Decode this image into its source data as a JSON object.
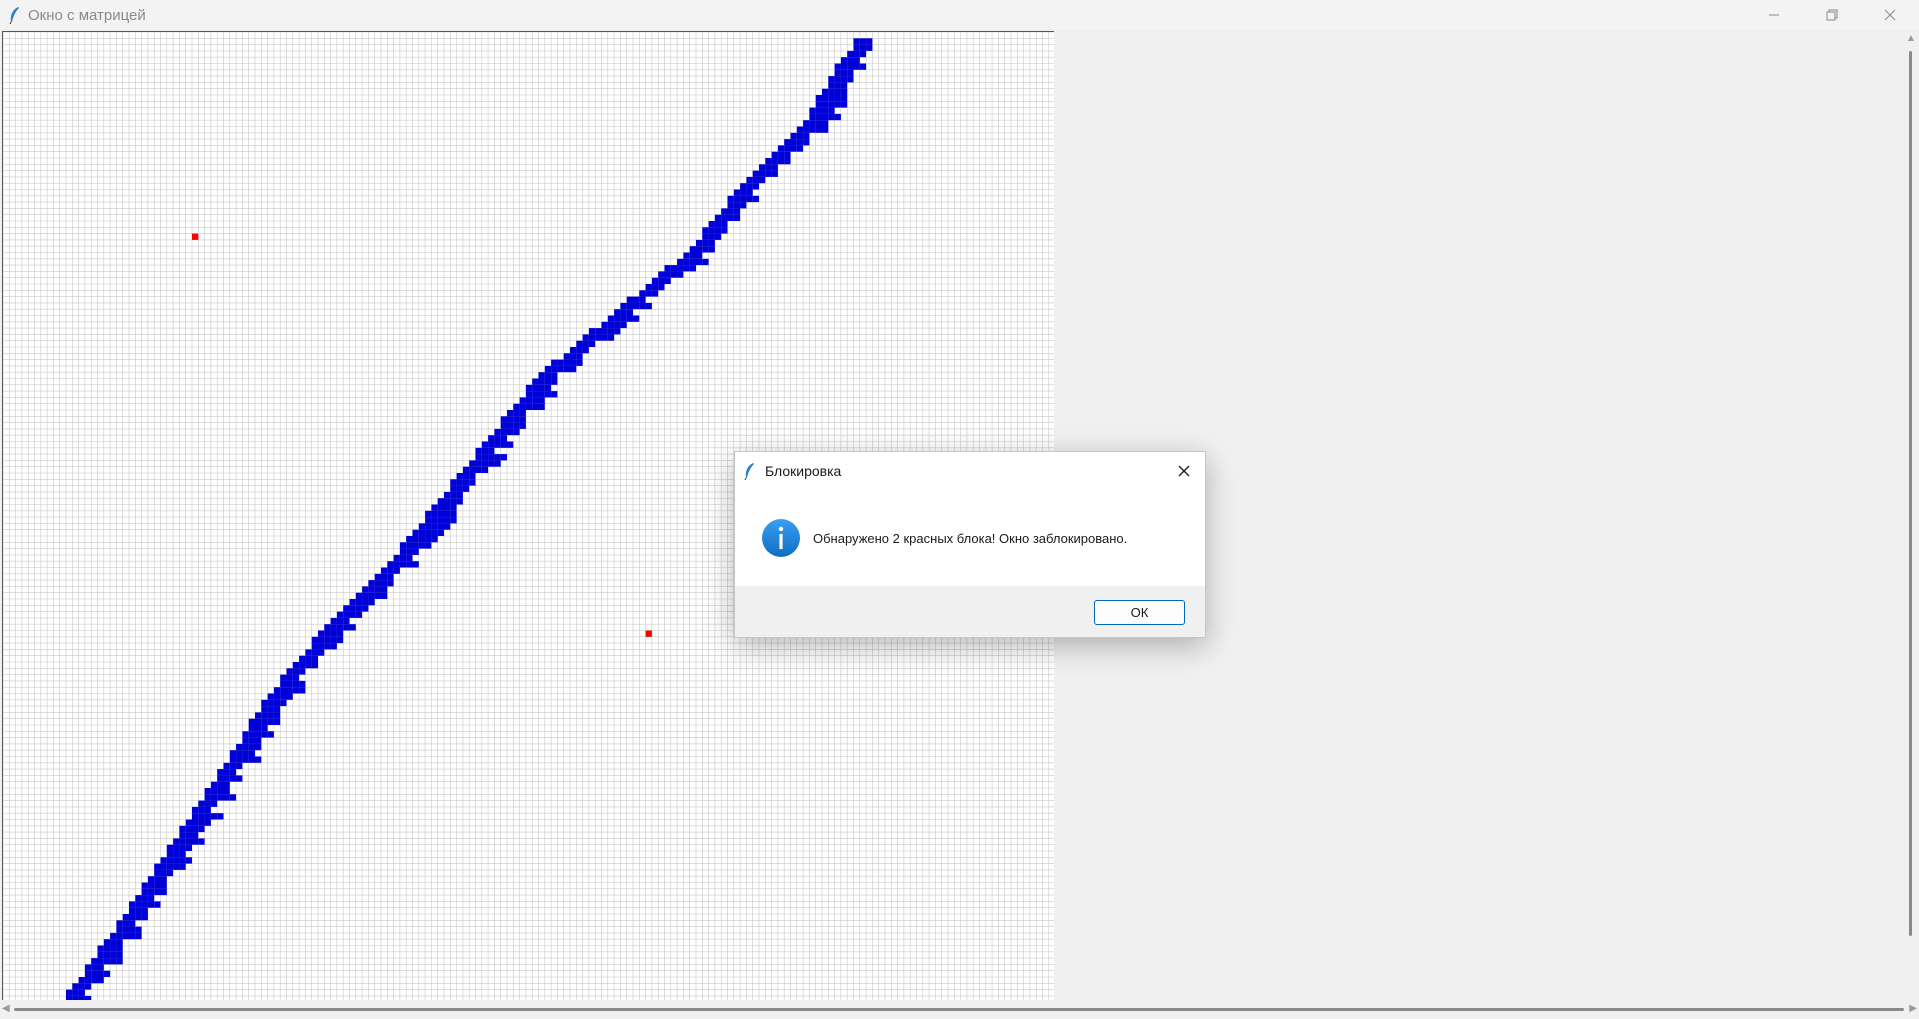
{
  "window": {
    "title": "Окно с матрицей",
    "minimize_icon": "minimize-icon",
    "maximize_icon": "restore-icon",
    "close_icon": "close-icon"
  },
  "matrix": {
    "grid_color": "#c8c8c8",
    "background": "#ffffff",
    "blue_color": "#0000d8",
    "red_color": "#ff0000",
    "red_blocks_count": 2
  },
  "dialog": {
    "title": "Блокировка",
    "message": "Обнаружено 2 красных блока! Окно заблокировано.",
    "ok_label": "ОК",
    "icon": "info-icon"
  },
  "colors": {
    "accent": "#0067c0",
    "info_icon": "#1e88e5"
  }
}
